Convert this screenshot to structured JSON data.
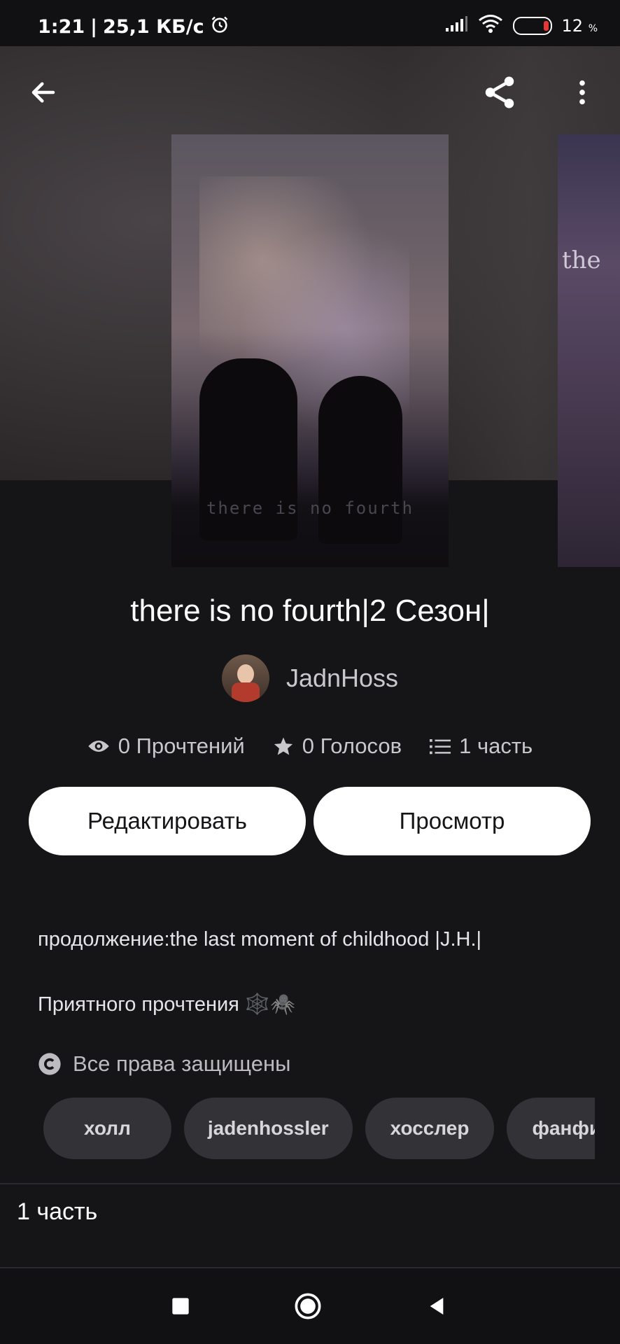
{
  "status_bar": {
    "time": "1:21",
    "separator": "|",
    "speed": "25,1 КБ/с",
    "battery": "12",
    "battery_unit": "%"
  },
  "top_bar": {
    "back_icon": "arrow-left-icon",
    "share_icon": "share-icon",
    "menu_icon": "more-vertical-icon"
  },
  "cover": {
    "caption": "there is no fourth",
    "next_cover_text": "the"
  },
  "book": {
    "title": "there is no fourth|2 Сезон|",
    "author": "JadnHoss"
  },
  "stats": {
    "reads": "0 Прочтений",
    "votes": "0 Голосов",
    "parts": "1 часть"
  },
  "buttons": {
    "edit": "Редактировать",
    "preview": "Просмотр"
  },
  "description": {
    "line1": "продолжение:the last moment of childhood |J.H.|",
    "line2": "Приятного прочтения 🕸️🕷️"
  },
  "rights": "Все права защищены",
  "tags": [
    "холл",
    "jadenhossler",
    "хосслер",
    "фанфики"
  ],
  "parts_section": {
    "label": "1 часть"
  },
  "colors": {
    "background": "#151416",
    "button": "#ffffff",
    "tag": "#333236"
  }
}
